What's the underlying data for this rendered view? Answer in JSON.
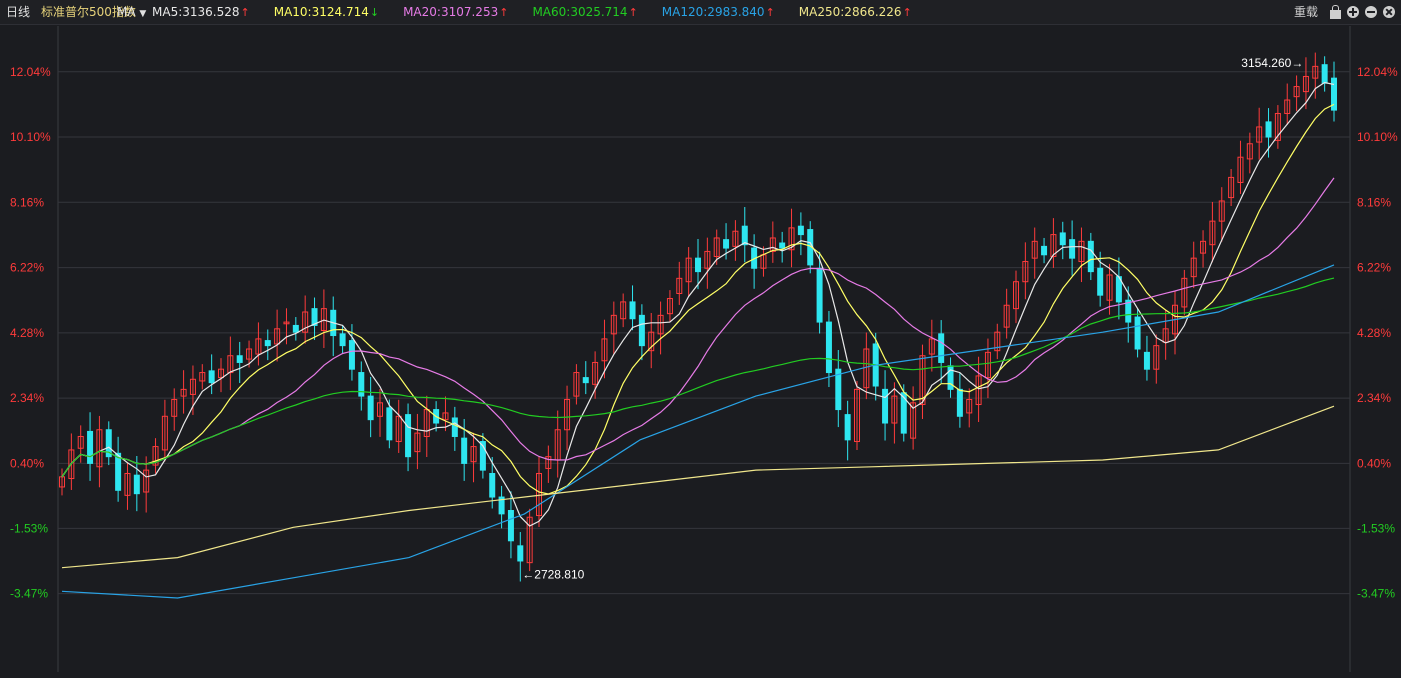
{
  "header": {
    "period": "日线",
    "index_name": "标准普尔500指数",
    "indicator": "MA",
    "ma_items": [
      {
        "label": "MA5:3136.528",
        "color": "#e8e8e8",
        "dir": "up"
      },
      {
        "label": "MA10:3124.714",
        "color": "#ffff66",
        "dir": "down"
      },
      {
        "label": "MA20:3107.253",
        "color": "#e67be6",
        "dir": "up"
      },
      {
        "label": "MA60:3025.714",
        "color": "#22cc22",
        "dir": "up"
      },
      {
        "label": "MA120:2983.840",
        "color": "#29a3e6",
        "dir": "up"
      },
      {
        "label": "MA250:2866.226",
        "color": "#f0e68c",
        "dir": "up"
      }
    ],
    "reload_label": "重载"
  },
  "colors": {
    "up": "#ff3b3b",
    "down": "#2ee6f0",
    "grid": "#35363c",
    "axis_up": "#ff3b3b",
    "axis_down": "#22cc22"
  },
  "chart_data": {
    "type": "candlestick",
    "title": "标准普尔500指数",
    "y_axis": {
      "unit": "percent",
      "ticks": [
        "12.04%",
        "10.10%",
        "8.16%",
        "6.22%",
        "4.28%",
        "2.34%",
        "0.40%",
        "-1.53%",
        "-3.47%"
      ],
      "tick_values": [
        12.04,
        10.1,
        8.16,
        6.22,
        4.28,
        2.34,
        0.4,
        -1.53,
        -3.47
      ],
      "range": [
        -5.8,
        13.4
      ]
    },
    "annotations": {
      "high": {
        "label": "3154.260→",
        "value_pct": 12.3,
        "index": 0
      },
      "low": {
        "label": "←2728.810",
        "value_pct": -2.9,
        "index": 0
      }
    },
    "closes_pct": [
      0.0,
      0.8,
      1.2,
      0.4,
      1.4,
      0.6,
      -0.4,
      0.1,
      -0.5,
      0.2,
      0.9,
      1.8,
      2.3,
      2.6,
      2.9,
      3.1,
      2.8,
      3.2,
      3.6,
      3.4,
      3.8,
      4.1,
      3.9,
      4.4,
      4.6,
      4.3,
      4.9,
      4.5,
      5.0,
      4.2,
      3.9,
      3.2,
      2.4,
      1.7,
      2.2,
      1.1,
      1.8,
      0.6,
      1.3,
      2.0,
      1.6,
      1.9,
      1.2,
      0.4,
      0.9,
      0.2,
      -0.6,
      -1.1,
      -1.9,
      -2.5,
      -1.2,
      0.1,
      0.6,
      1.4,
      2.3,
      3.1,
      2.8,
      3.4,
      4.1,
      4.8,
      5.2,
      4.7,
      3.9,
      4.3,
      4.8,
      5.3,
      5.9,
      6.5,
      6.1,
      6.7,
      7.1,
      6.8,
      7.3,
      6.9,
      6.2,
      6.6,
      7.1,
      6.8,
      7.4,
      7.2,
      6.3,
      4.6,
      3.1,
      2.0,
      1.1,
      2.6,
      3.8,
      2.7,
      1.6,
      2.4,
      1.3,
      2.2,
      3.6,
      4.1,
      3.4,
      2.6,
      1.8,
      2.3,
      3.0,
      3.7,
      4.3,
      5.1,
      5.8,
      6.4,
      7.0,
      6.6,
      7.2,
      6.9,
      6.5,
      7.0,
      6.1,
      5.4,
      6.0,
      5.2,
      4.6,
      3.8,
      3.2,
      3.9,
      4.4,
      5.1,
      5.9,
      6.5,
      7.0,
      7.6,
      8.2,
      8.9,
      9.5,
      9.9,
      10.4,
      10.1,
      10.8,
      11.2,
      11.6,
      11.9,
      12.2,
      11.7,
      10.9
    ],
    "moving_averages": {
      "MA250": [
        -2.7,
        -2.4,
        -1.5,
        -1.0,
        -0.6,
        -0.2,
        0.2,
        0.3,
        0.4,
        0.5,
        0.8,
        2.1
      ],
      "MA120": [
        -3.4,
        -3.6,
        -3.0,
        -2.4,
        -1.1,
        1.1,
        2.4,
        3.3,
        3.8,
        4.3,
        4.9,
        6.3
      ]
    }
  }
}
